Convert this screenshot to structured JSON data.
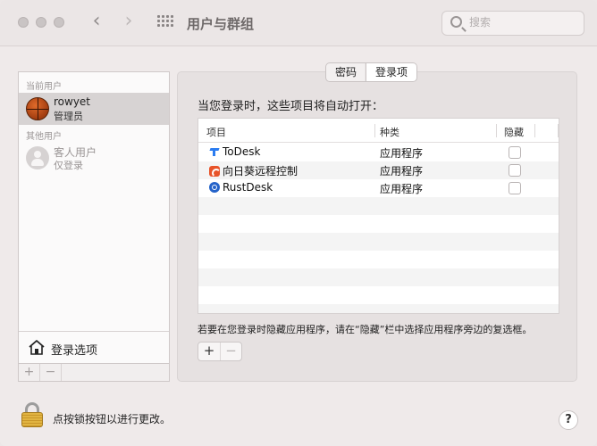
{
  "window": {
    "title": "用户与群组"
  },
  "search": {
    "placeholder": "搜索"
  },
  "users": {
    "current_label": "当前用户",
    "current": {
      "name": "rowyet",
      "role": "管理员"
    },
    "other_label": "其他用户",
    "guest": {
      "name": "客人用户",
      "role": "仅登录"
    },
    "login_options_label": "登录选项",
    "add_label": "+",
    "remove_label": "−"
  },
  "tabs": [
    {
      "label": "密码",
      "active": false
    },
    {
      "label": "登录项",
      "active": true
    }
  ],
  "login_items": {
    "intro": "当您登录时，这些项目将自动打开：",
    "columns": {
      "item": "项目",
      "kind": "种类",
      "hide": "隐藏"
    },
    "rows": [
      {
        "name": "ToDesk",
        "kind": "应用程序",
        "hidden": false,
        "icon": "todesk-icon"
      },
      {
        "name": "向日葵远程控制",
        "kind": "应用程序",
        "hidden": false,
        "icon": "sunlogin-icon"
      },
      {
        "name": "RustDesk",
        "kind": "应用程序",
        "hidden": false,
        "icon": "rustdesk-icon"
      }
    ],
    "hint": "若要在您登录时隐藏应用程序，请在“隐藏”栏中选择应用程序旁边的复选框。",
    "add_label": "+",
    "remove_label": "−"
  },
  "footer": {
    "lock_text": "点按锁按钮以进行更改。",
    "help_label": "?"
  },
  "colors": {
    "selected_row": "#d7d3d3",
    "window_bg": "#efeaea",
    "accent_lock": "#e1b441"
  }
}
